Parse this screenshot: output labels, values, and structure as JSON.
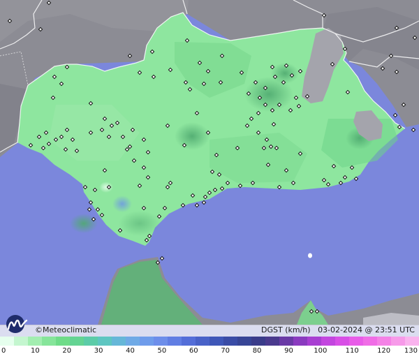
{
  "credit": {
    "symbol": "©",
    "name": "Meteoclimatic"
  },
  "info": {
    "variable": "DGST",
    "unit": "(km/h)",
    "datetime": "03-02-2024 @ 23:51 UTC"
  },
  "scale": {
    "ticks": [
      "0",
      "10",
      "20",
      "30",
      "40",
      "50",
      "60",
      "70",
      "80",
      "90",
      "100",
      "110",
      "120",
      "130"
    ],
    "colors": [
      "#e6ffee",
      "#c4f6cf",
      "#a2eeb0",
      "#86e59a",
      "#6fdc88",
      "#64d493",
      "#5ccca8",
      "#5ec6c1",
      "#66b7d8",
      "#6faae6",
      "#6f9ceb",
      "#6d8eea",
      "#617ee3",
      "#546ed8",
      "#4962c8",
      "#3f57b8",
      "#3a4ca6",
      "#374596",
      "#3a3c8a",
      "#4a3a8e",
      "#6a3aa6",
      "#8a3bbf",
      "#a83fd2",
      "#c346df",
      "#d84fe6",
      "#e85ce8",
      "#f06de6",
      "#f482e6",
      "#f79ae9",
      "#fab3ee"
    ]
  },
  "map": {
    "sea_color": "#7b87dc",
    "land_color": "#8ee69f",
    "terrain_color": "#8c8c94",
    "high_terrain_color": "#bcbcc6"
  }
}
